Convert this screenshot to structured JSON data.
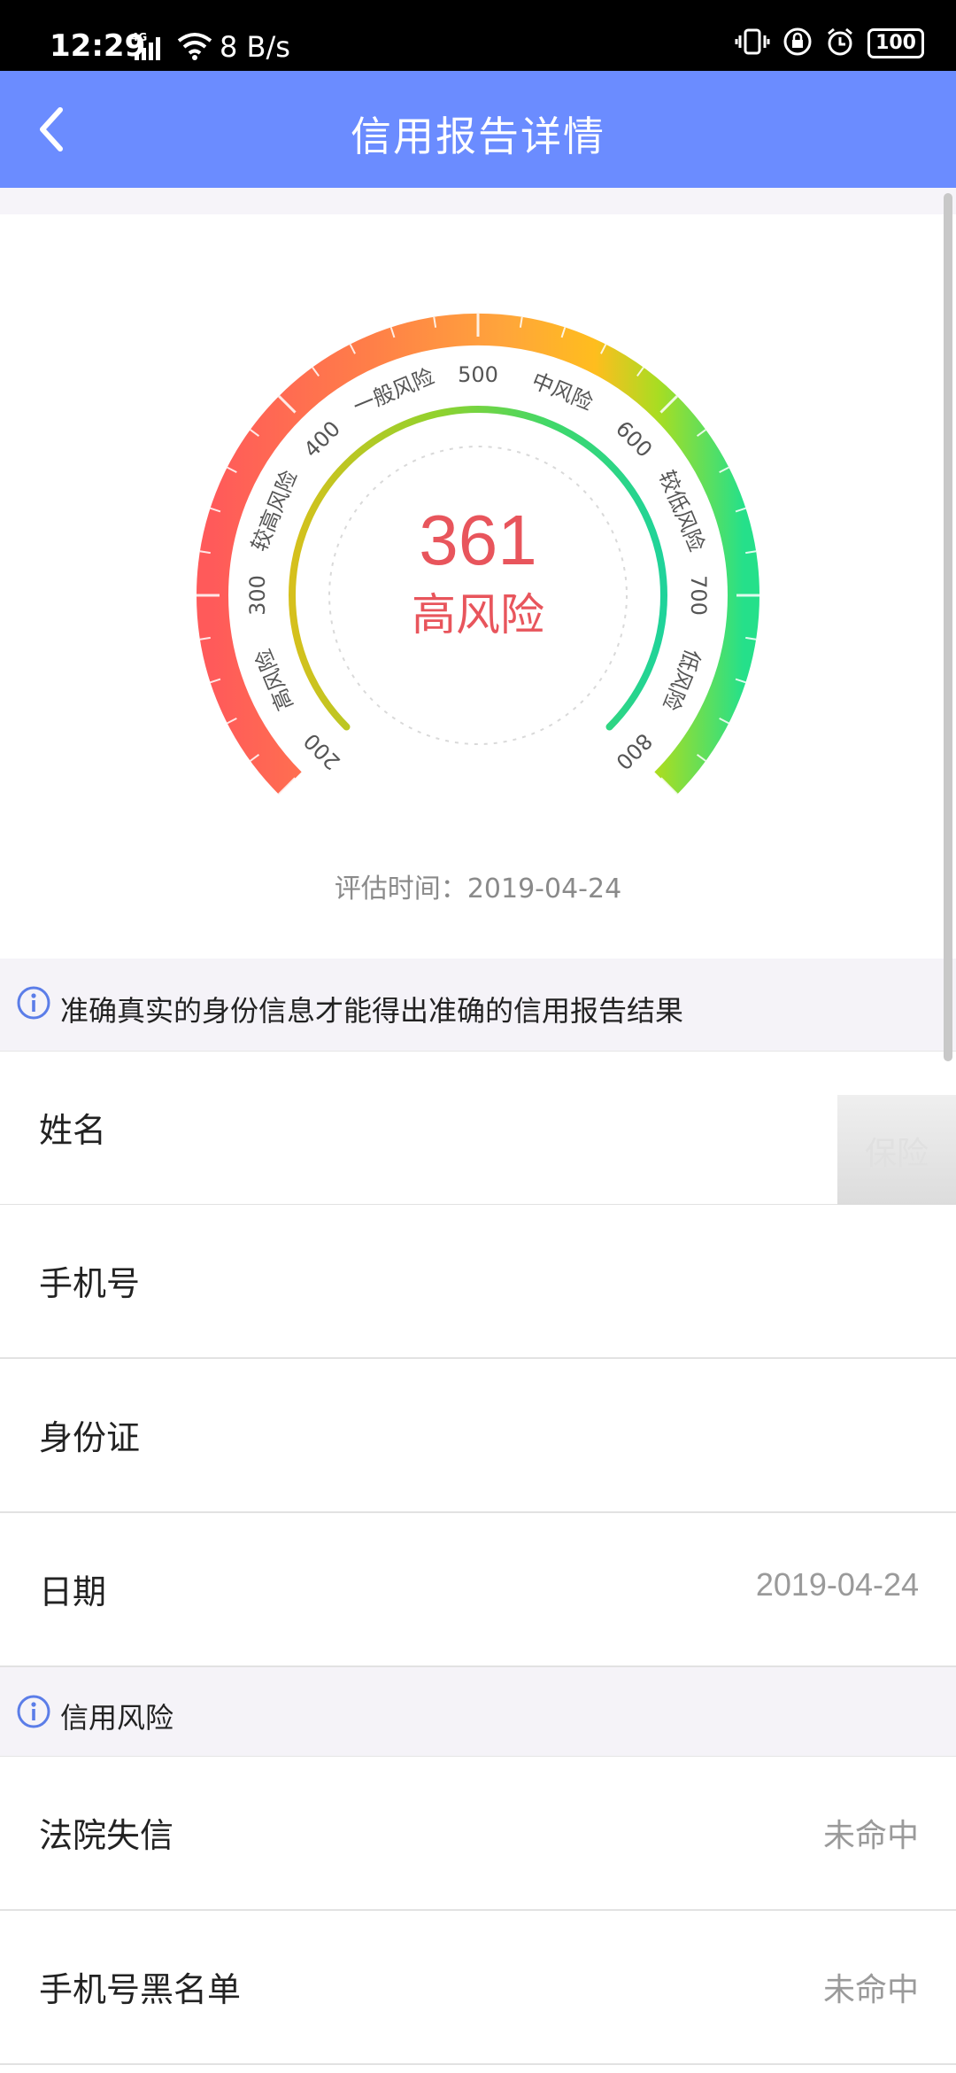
{
  "status_bar": {
    "time": "12:29",
    "net": "4G",
    "speed": "8 B/s",
    "battery": "100"
  },
  "header": {
    "title": "信用报告详情"
  },
  "gauge": {
    "score": "361",
    "level": "高风险",
    "scale_min": 200,
    "scale_max": 800,
    "score_value": 361,
    "ticks": [
      "200",
      "300",
      "400",
      "500",
      "600",
      "700",
      "800"
    ],
    "bands": [
      "高风险",
      "较高风险",
      "一般风险",
      "中风险",
      "较低风险",
      "低风险"
    ],
    "colors": {
      "red": "#ff5f5f",
      "orange": "#ffa63a",
      "yellow": "#ffbf1e",
      "green": "#2fe07f",
      "inner_start": "#d4c21a",
      "inner_end": "#1fd39a"
    },
    "eval_label": "评估时间：",
    "eval_date": "2019-04-24"
  },
  "section_identity": {
    "text": "准确真实的身份信息才能得出准确的信用报告结果"
  },
  "identity_rows": [
    {
      "label": "姓名",
      "value": ""
    },
    {
      "label": "手机号",
      "value": ""
    },
    {
      "label": "身份证",
      "value": ""
    },
    {
      "label": "日期",
      "value": "2019-04-24"
    }
  ],
  "watermark_text": "保险",
  "section_risk": {
    "text": "信用风险"
  },
  "risk_rows": [
    {
      "label": "法院失信",
      "value": "未命中"
    },
    {
      "label": "手机号黑名单",
      "value": "未命中"
    }
  ],
  "accent_color": "#6b8cff"
}
